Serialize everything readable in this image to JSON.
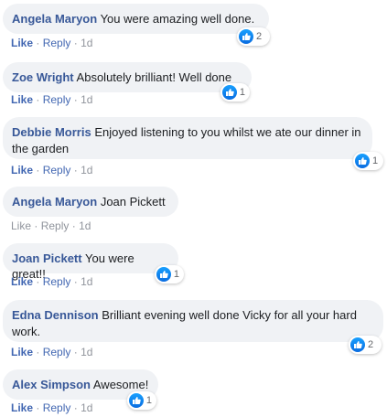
{
  "actions": {
    "like": "Like",
    "reply": "Reply",
    "sep": "·"
  },
  "comments": [
    {
      "author": "Angela Maryon",
      "text": "You were amazing well done.",
      "time": "1d",
      "reactions": "2"
    },
    {
      "author": "Zoe Wright",
      "text": "Absolutely brilliant! Well done",
      "time": "1d",
      "reactions": "1"
    },
    {
      "author": "Debbie Morris",
      "text": "Enjoyed listening to you whilst we ate our dinner in the garden",
      "time": "1d",
      "reactions": "1"
    },
    {
      "author": "Angela Maryon",
      "text": "Joan Pickett",
      "time": "1d",
      "reactions": null
    },
    {
      "author": "Joan Pickett",
      "text": "You were great!!",
      "time": "1d",
      "reactions": "1"
    },
    {
      "author": "Edna Dennison",
      "text": "Brilliant evening well done Vicky for all your hard work.",
      "time": "1d",
      "reactions": "2"
    },
    {
      "author": "Alex Simpson",
      "text": "Awesome!",
      "time": "1d",
      "reactions": "1"
    }
  ]
}
